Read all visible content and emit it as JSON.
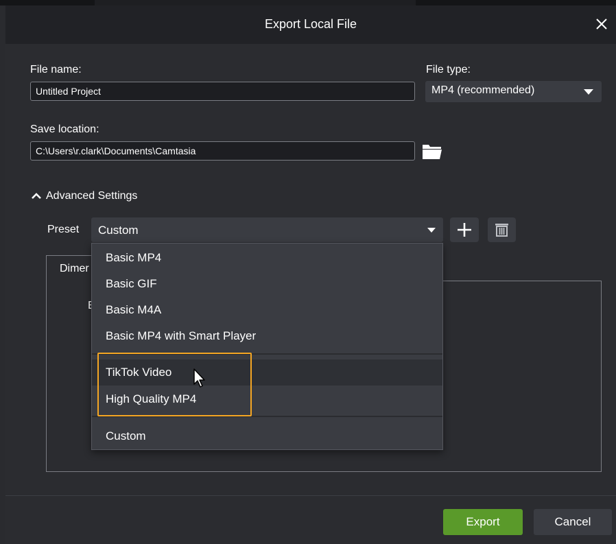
{
  "dialog": {
    "title": "Export Local File"
  },
  "file_name": {
    "label": "File name:",
    "value": "Untitled Project"
  },
  "file_type": {
    "label": "File type:",
    "selected": "MP4 (recommended)"
  },
  "save_location": {
    "label": "Save location:",
    "value": "C:\\Users\\r.clark\\Documents\\Camtasia"
  },
  "advanced": {
    "label": "Advanced Settings",
    "expanded": true
  },
  "preset": {
    "label": "Preset",
    "selected": "Custom",
    "options": [
      {
        "label": "Basic MP4"
      },
      {
        "label": "Basic GIF"
      },
      {
        "label": "Basic M4A"
      },
      {
        "label": "Basic MP4 with Smart Player"
      },
      {
        "label": "TikTok Video"
      },
      {
        "label": "High Quality MP4"
      },
      {
        "label": "Custom"
      }
    ],
    "hovered_option": "TikTok Video"
  },
  "tab_partial_label": "Dimer",
  "hidden_label_fragment": "E",
  "buttons": {
    "export": "Export",
    "cancel": "Cancel"
  },
  "colors": {
    "highlight": "#f5a623",
    "export_button": "#5a9a2a",
    "hover_row": "#2e3035"
  },
  "icons": [
    "close-icon",
    "folder-icon",
    "chevron-up-icon",
    "caret-down-icon",
    "plus-icon",
    "trash-icon",
    "mouse-cursor-icon"
  ]
}
